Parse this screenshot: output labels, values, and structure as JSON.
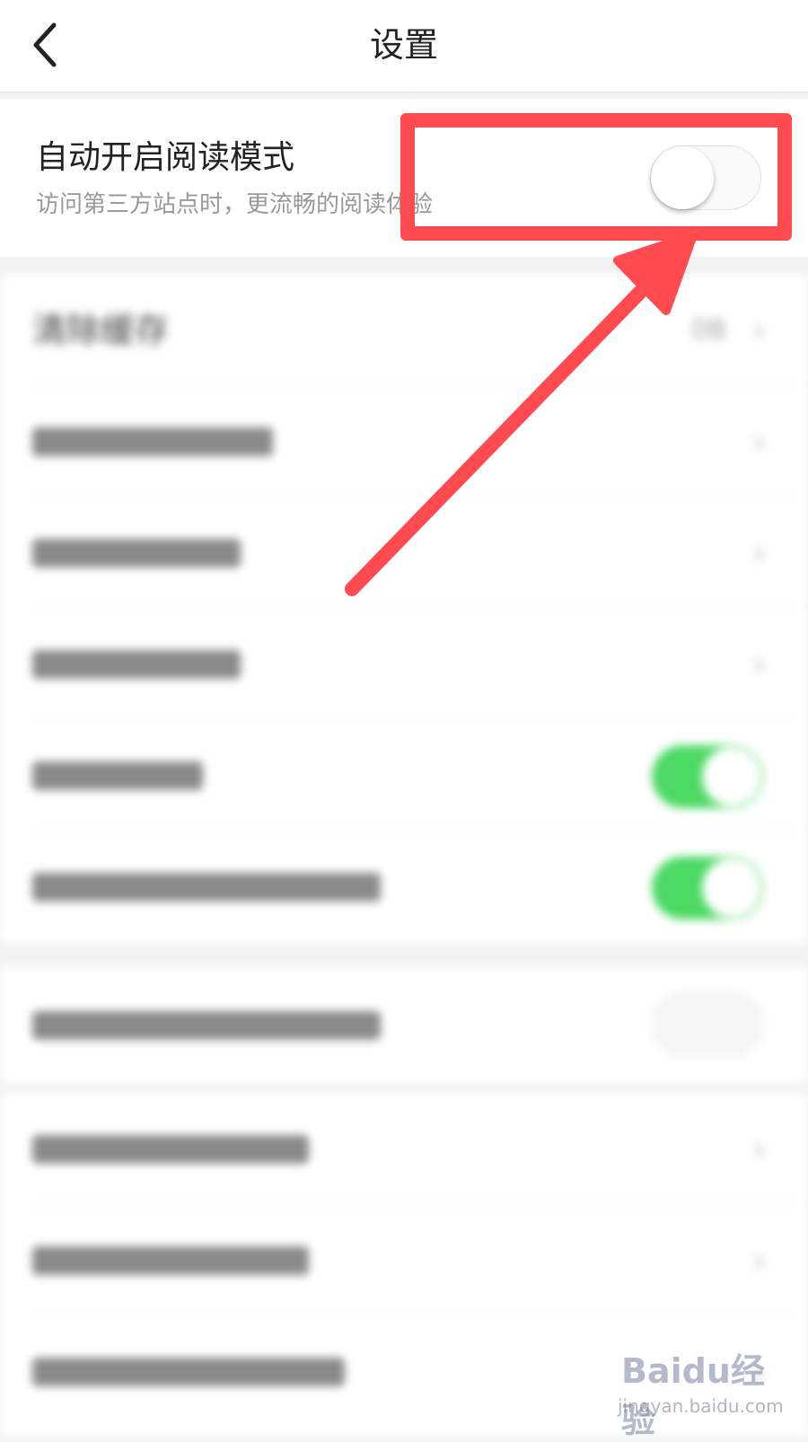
{
  "header": {
    "title": "设置",
    "back_icon": "chevron-left-icon"
  },
  "reader_mode": {
    "title": "自动开启阅读模式",
    "subtitle": "访问第三方站点时，更流畅的阅读体验",
    "toggle_on": false
  },
  "clear_cache": {
    "label": "清除缓存",
    "value": "0B",
    "icon": "chevron-right-icon"
  },
  "blurred_rows": [
    {
      "kind": "chevron"
    },
    {
      "kind": "chevron"
    },
    {
      "kind": "chevron"
    },
    {
      "kind": "toggle",
      "toggle_on": true
    },
    {
      "kind": "toggle",
      "toggle_on": true
    },
    {
      "kind": "toggle",
      "toggle_on": false
    },
    {
      "kind": "chevron"
    },
    {
      "kind": "chevron"
    },
    {
      "kind": "chevron"
    }
  ],
  "colors": {
    "annotation": "#ff4b4f",
    "toggle_on": "#4cd964"
  },
  "watermark": {
    "brand": "Baidu经验",
    "url": "jingyan.baidu.com"
  }
}
